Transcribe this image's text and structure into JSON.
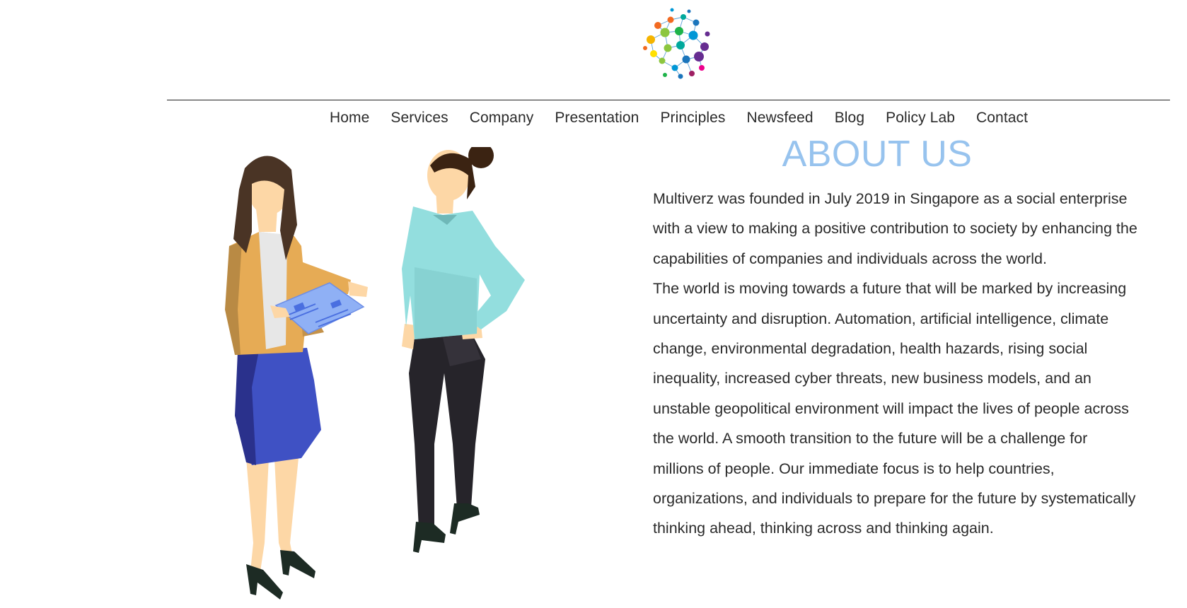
{
  "brand": {
    "logo_icon": "network-dots-logo-icon",
    "logo_colors": [
      "#f26a21",
      "#f5b400",
      "#ffe000",
      "#8cc63f",
      "#1eb34a",
      "#00a99d",
      "#0097d6",
      "#1b75bc",
      "#662d91",
      "#9e1f63",
      "#ec008c"
    ]
  },
  "nav": {
    "items": [
      {
        "label": "Home"
      },
      {
        "label": "Services"
      },
      {
        "label": "Company"
      },
      {
        "label": "Presentation"
      },
      {
        "label": "Principles"
      },
      {
        "label": "Newsfeed"
      },
      {
        "label": "Blog"
      },
      {
        "label": "Policy Lab"
      },
      {
        "label": "Contact"
      }
    ]
  },
  "about": {
    "title": "ABOUT US",
    "title_color": "#97c3ee",
    "paragraph_1": "Multiverz was founded in July 2019 in Singapore as a social enterprise with a view to making a positive contribution to society by enhancing the capabilities of companies and individuals across the world.",
    "paragraph_2": "The world is moving towards a future that will be marked by increasing uncertainty and disruption. Automation, artificial intelligence, climate change,  environmental degradation, health hazards, rising social inequality, increased cyber threats, new business models, and an unstable geopolitical environment will impact the lives of people across the world. A smooth transition to the future will be a challenge for millions of people. Our immediate focus is to help countries, organizations, and individuals to prepare for the future by systematically thinking ahead, thinking across and thinking again."
  },
  "illustration": {
    "icon": "two-women-talking-illustration-icon"
  }
}
